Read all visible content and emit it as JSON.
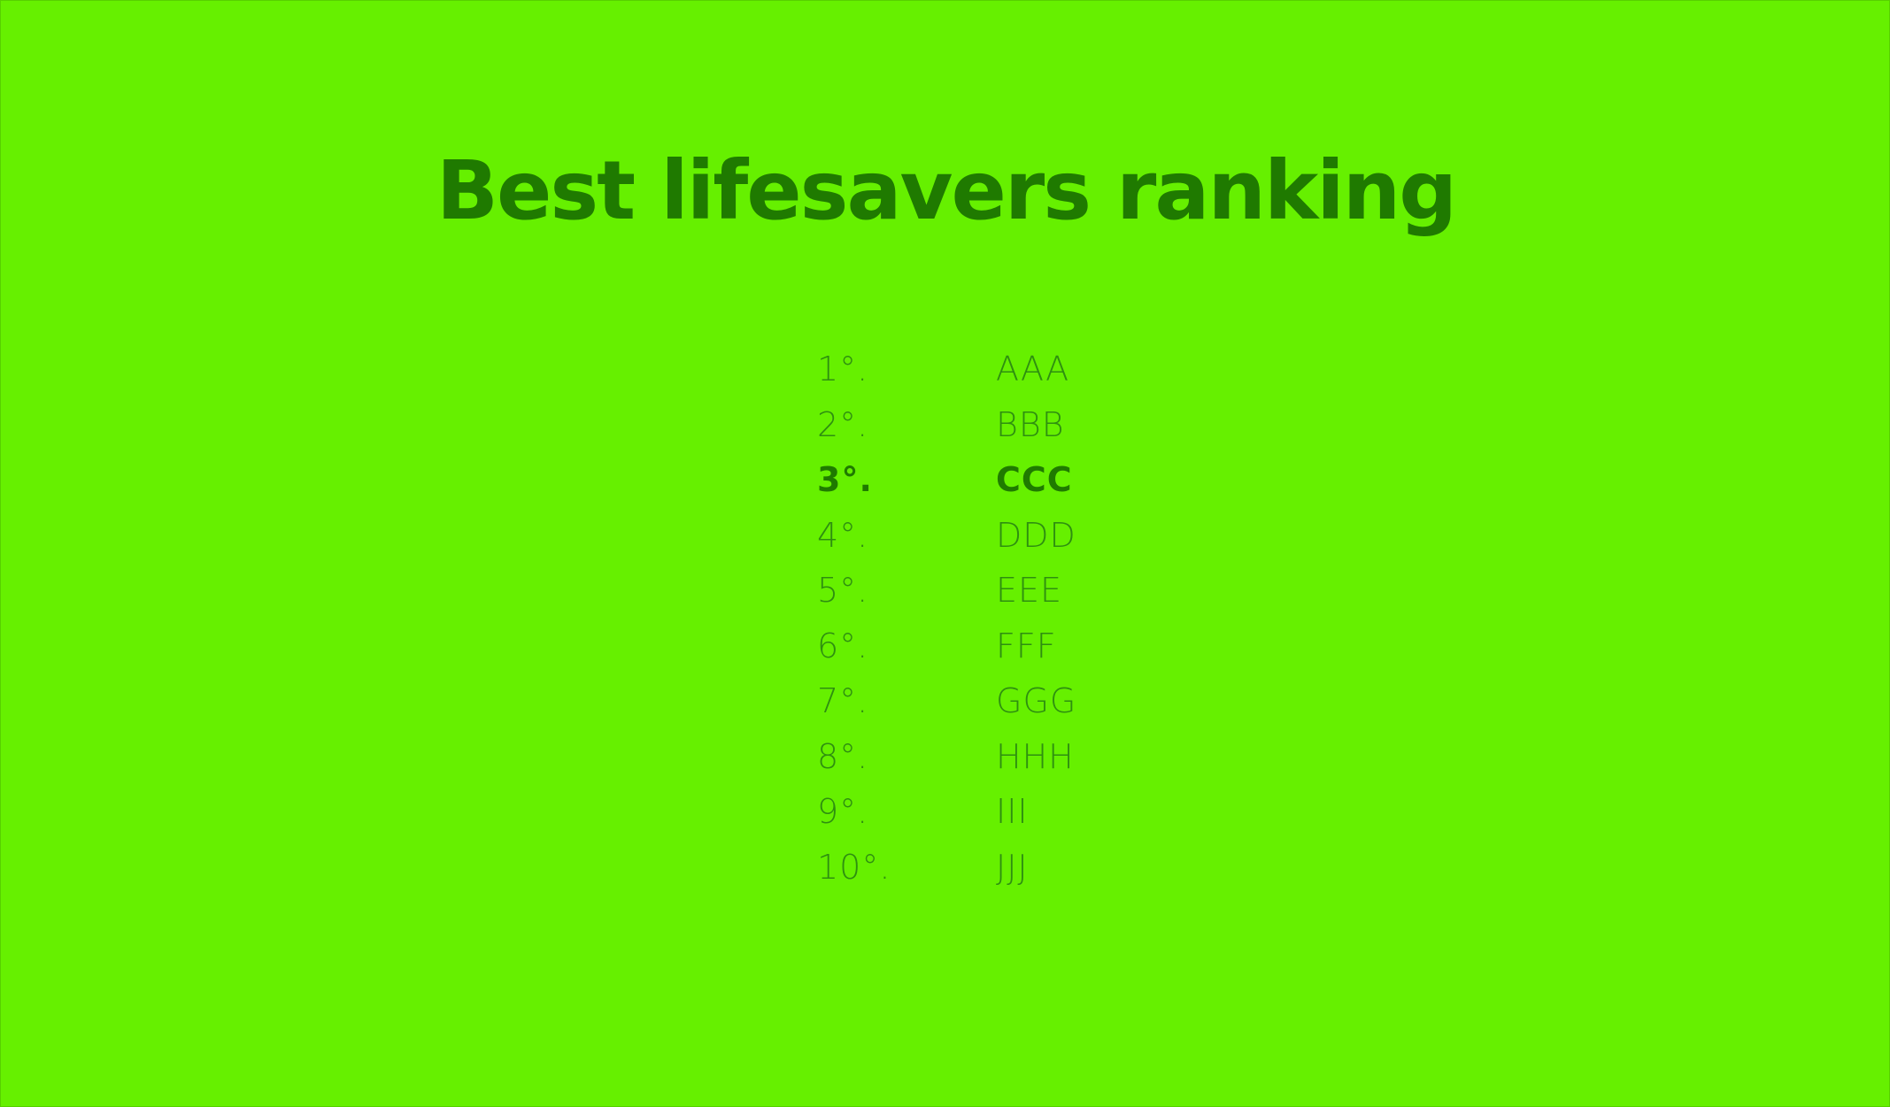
{
  "title": "Best lifesavers ranking",
  "colors": {
    "background": "#66f000",
    "title": "#1f7a00",
    "text": "#2e8f10"
  },
  "ranking": [
    {
      "rank": "1°.",
      "name": "AAA",
      "highlight": false
    },
    {
      "rank": "2°.",
      "name": "BBB",
      "highlight": false
    },
    {
      "rank": "3°.",
      "name": "CCC",
      "highlight": true
    },
    {
      "rank": "4°.",
      "name": "DDD",
      "highlight": false
    },
    {
      "rank": "5°.",
      "name": "EEE",
      "highlight": false
    },
    {
      "rank": "6°.",
      "name": "FFF",
      "highlight": false
    },
    {
      "rank": "7°.",
      "name": "GGG",
      "highlight": false
    },
    {
      "rank": "8°.",
      "name": "HHH",
      "highlight": false
    },
    {
      "rank": "9°.",
      "name": "III",
      "highlight": false
    },
    {
      "rank": "10°.",
      "name": "JJJ",
      "highlight": false
    }
  ]
}
